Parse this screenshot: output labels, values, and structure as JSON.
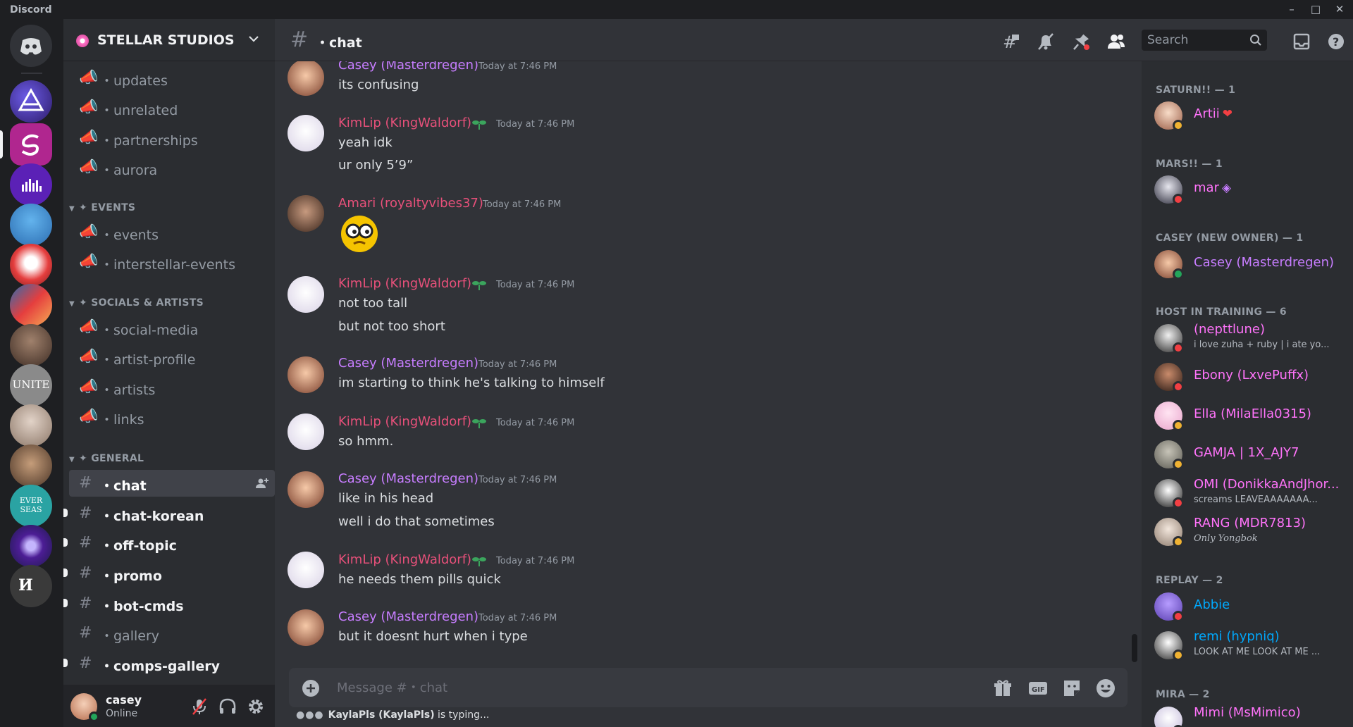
{
  "app": {
    "title": "Discord"
  },
  "colors": {
    "casey": "#c77dff",
    "kimlip": "#e7507a",
    "amari": "#e7507a",
    "link_blue": "#00a8fc",
    "pink": "#ff73fa"
  },
  "rail": {
    "servers": [
      {
        "name": "Direct Messages",
        "icon": "discord-logo-icon"
      },
      {
        "name": "server-1",
        "icon": "triangle-logo-icon"
      },
      {
        "name": "server-2",
        "icon": "s-logo-icon",
        "active": true
      },
      {
        "name": "server-3",
        "icon": "equalizer-icon"
      },
      {
        "name": "server-4",
        "icon": "cvs-logo-icon"
      },
      {
        "name": "server-5",
        "icon": "character-icon"
      },
      {
        "name": "server-6",
        "icon": "artwork-icon"
      },
      {
        "name": "server-7",
        "icon": "portrait-icon"
      },
      {
        "name": "server-8",
        "icon": "unite-logo-icon"
      },
      {
        "name": "server-9",
        "icon": "portrait-icon"
      },
      {
        "name": "server-10",
        "icon": "monkey-icon"
      },
      {
        "name": "server-11",
        "icon": "ever-seas-icon"
      },
      {
        "name": "server-12",
        "icon": "orb-icon"
      },
      {
        "name": "server-13",
        "icon": "letters-logo-icon"
      }
    ],
    "server_labels": {
      "unite": "UNITE",
      "ever": "EVER SEAS"
    }
  },
  "sidebar": {
    "server_name": "STELLAR STUDIOS",
    "channels_top": [
      {
        "name": "・updates",
        "icon": "announcement-icon"
      },
      {
        "name": "・unrelated",
        "icon": "announcement-icon"
      },
      {
        "name": "・partnerships",
        "icon": "announcement-icon"
      },
      {
        "name": "・aurora",
        "icon": "announcement-icon"
      }
    ],
    "categories": {
      "events": "✦ EVENTS",
      "socials": "✦ SOCIALS & ARTISTS",
      "general": "✦ GENERAL"
    },
    "events_channels": [
      {
        "name": "・events"
      },
      {
        "name": "・interstellar-events"
      }
    ],
    "socials_channels": [
      {
        "name": "・social-media"
      },
      {
        "name": "・artist-profile"
      },
      {
        "name": "・artists"
      },
      {
        "name": "・links"
      }
    ],
    "general_channels": [
      {
        "name": "・chat",
        "selected": true
      },
      {
        "name": "・chat-korean",
        "unread": true
      },
      {
        "name": "・off-topic",
        "unread": true
      },
      {
        "name": "・promo",
        "unread": true
      },
      {
        "name": "・bot-cmds",
        "unread": true
      },
      {
        "name": "・gallery"
      },
      {
        "name": "・comps-gallery",
        "unread": true
      }
    ]
  },
  "user": {
    "name": "casey",
    "status": "Online"
  },
  "header": {
    "channel": "・chat",
    "search_placeholder": "Search"
  },
  "messages": [
    {
      "author": "Casey (Masterdregen)",
      "time": "Today at 7:46 PM",
      "lines": [
        "its confusing"
      ],
      "color": "casey"
    },
    {
      "author": "KimLip (KingWaldorf)",
      "time": "Today at 7:46 PM",
      "lines": [
        "yeah idk",
        "ur only 5’9”"
      ],
      "color": "kimlip",
      "badge": true
    },
    {
      "author": "Amari (royaltyvibes37)",
      "time": "Today at 7:46 PM",
      "lines": [],
      "emoji": true,
      "color": "amari"
    },
    {
      "author": "KimLip (KingWaldorf)",
      "time": "Today at 7:46 PM",
      "lines": [
        "not too tall",
        "but not too short"
      ],
      "color": "kimlip",
      "badge": true
    },
    {
      "author": "Casey (Masterdregen)",
      "time": "Today at 7:46 PM",
      "lines": [
        "im starting to think he's talking to himself"
      ],
      "color": "casey"
    },
    {
      "author": "KimLip (KingWaldorf)",
      "time": "Today at 7:46 PM",
      "lines": [
        "so hmm."
      ],
      "color": "kimlip",
      "badge": true
    },
    {
      "author": "Casey (Masterdregen)",
      "time": "Today at 7:46 PM",
      "lines": [
        "like in his head",
        "well i do that sometimes"
      ],
      "color": "casey"
    },
    {
      "author": "KimLip (KingWaldorf)",
      "time": "Today at 7:46 PM",
      "lines": [
        "he needs them pills quick"
      ],
      "color": "kimlip",
      "badge": true
    },
    {
      "author": "Casey (Masterdregen)",
      "time": "Today at 7:46 PM",
      "lines": [
        "but it doesnt hurt when i type"
      ],
      "color": "casey"
    }
  ],
  "composer": {
    "placeholder": "Message #・chat"
  },
  "typing": {
    "user": "KaylaPls (KaylaPls)",
    "suffix": " is typing..."
  },
  "members": {
    "groups": [
      {
        "title": "SATURN!! — 1",
        "members": [
          {
            "name": "Artii",
            "role_icon": "❤",
            "status": "idle",
            "color": "#ff73fa"
          }
        ]
      },
      {
        "title": "MARS!! — 1",
        "members": [
          {
            "name": "mar",
            "role_icon": "◈",
            "status": "dnd",
            "color": "#ff73fa"
          }
        ]
      },
      {
        "title": "CASEY (NEW OWNER) — 1",
        "members": [
          {
            "name": "Casey (Masterdregen)",
            "status": "online",
            "color": "#c77dff"
          }
        ]
      },
      {
        "title": "HOST IN TRAINING — 6",
        "members": [
          {
            "name": "(nepttlune)",
            "sub": "i love zuha + ruby | i ate yo...",
            "status": "dnd",
            "color": "#ff73fa"
          },
          {
            "name": "Ebony (LxvePuffx)",
            "status": "dnd",
            "color": "#ff73fa"
          },
          {
            "name": "Ella (MilaElla0315)",
            "status": "idle",
            "color": "#ff73fa"
          },
          {
            "name": "GAMJA | 1X_AJY7",
            "status": "idle",
            "color": "#ff73fa"
          },
          {
            "name": "OMI (DonikkaAndJhor...",
            "sub": "screams LEAVEAAAAAAA...",
            "status": "dnd",
            "color": "#ff73fa"
          },
          {
            "name": "RANG (MDR7813)",
            "sub": "Only Yongbok",
            "status": "idle",
            "color": "#ff73fa"
          }
        ]
      },
      {
        "title": "REPLAY — 2",
        "members": [
          {
            "name": "Abbie",
            "status": "dnd",
            "color": "#00a8fc"
          },
          {
            "name": "remi (hypniq)",
            "sub": "LOOK AT ME LOOK AT ME ...",
            "status": "idle",
            "color": "#00a8fc"
          }
        ]
      },
      {
        "title": "MIRA — 2",
        "members": [
          {
            "name": "Mimi (MsMimico)",
            "status": "dnd",
            "color": "#ff73fa"
          }
        ]
      }
    ]
  }
}
